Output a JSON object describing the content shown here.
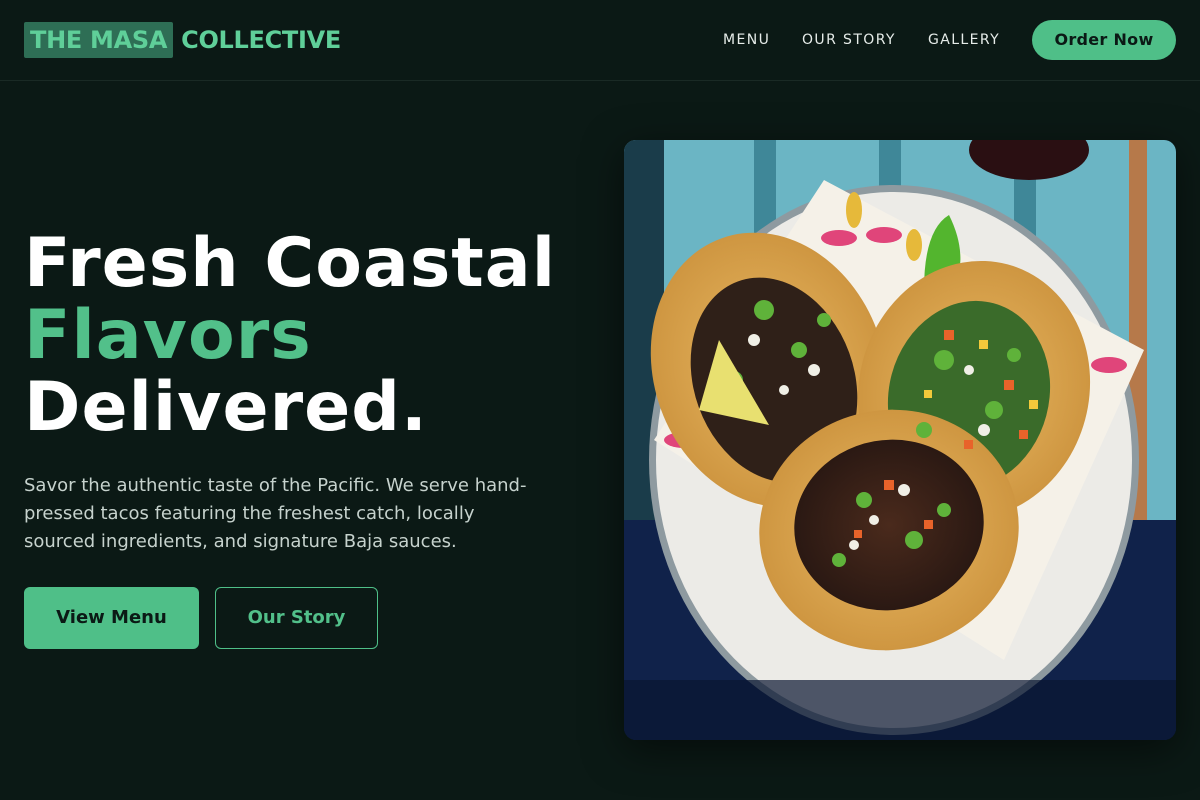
{
  "brand": {
    "logo_box_text": "THE MASA",
    "logo_rest_text": "COLLECTIVE"
  },
  "nav": {
    "items": [
      "MENU",
      "OUR STORY",
      "GALLERY"
    ],
    "cta": "Order Now"
  },
  "hero": {
    "headline_line1": "Fresh Coastal",
    "headline_line2": "Flavors",
    "headline_line3": "Delivered.",
    "description": "Savor the authentic taste of the Pacific. We serve hand-pressed tacos featuring the freshest catch, locally sourced ingredients, and signature Baja sauces.",
    "primary_button": "View Menu",
    "secondary_button": "Our Story"
  },
  "image": {
    "icon": "tacos-photo"
  },
  "colors": {
    "background": "#0b1915",
    "accent": "#4fbf88",
    "logo_box": "#2e6e55"
  }
}
